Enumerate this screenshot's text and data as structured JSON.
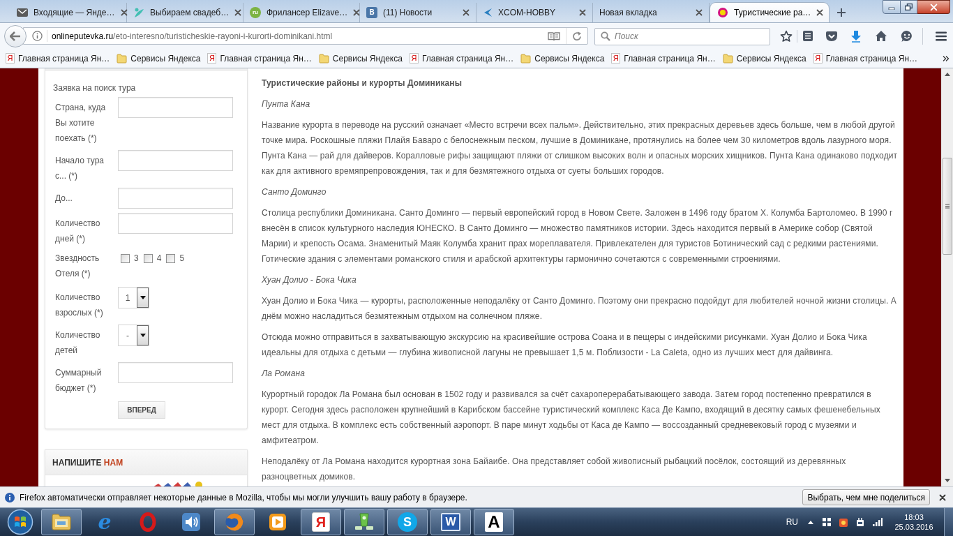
{
  "tabs": [
    {
      "title": "Входящие — Янде…",
      "kind": "mail",
      "selected": false
    },
    {
      "title": "Выбираем свадеб…",
      "kind": "bird",
      "selected": false
    },
    {
      "title": "Фрилансер Elizave…",
      "kind": "round_letter",
      "icon_text": "ru",
      "selected": false
    },
    {
      "title": "(11) Новости",
      "kind": "square_letter",
      "icon_text": "В",
      "selected": false
    },
    {
      "title": "XCOM-HOBBY",
      "kind": "chevron",
      "selected": false
    },
    {
      "title": "Новая вкладка",
      "kind": "plain",
      "selected": false
    },
    {
      "title": "Туристические ра…",
      "kind": "ring",
      "selected": true
    }
  ],
  "address_bar": {
    "domain": "onlineputevka.ru",
    "path": "/eto-interesno/turisticheskie-rayoni-i-kurorti-dominikani.html"
  },
  "search": {
    "placeholder": "Поиск"
  },
  "bookmarks": [
    {
      "kind": "letter",
      "icon_text": "Я",
      "label": "Главная страница Ян…"
    },
    {
      "kind": "folder",
      "label": "Сервисы Яндекса"
    },
    {
      "kind": "letter",
      "icon_text": "Я",
      "label": "Главная страница Ян…"
    },
    {
      "kind": "folder",
      "label": "Сервисы Яндекса"
    },
    {
      "kind": "letter",
      "icon_text": "Я",
      "label": "Главная страница Ян…"
    },
    {
      "kind": "folder",
      "label": "Сервисы Яндекса"
    },
    {
      "kind": "letter",
      "icon_text": "Я",
      "label": "Главная страница Ян…"
    },
    {
      "kind": "folder",
      "label": "Сервисы Яндекса"
    },
    {
      "kind": "letter",
      "icon_text": "Я",
      "label": "Главная страница Ян…"
    }
  ],
  "form": {
    "title": "Заявка на поиск тура",
    "fields": [
      {
        "kind": "text",
        "label": "Страна, куда Вы хотите поехать (*)"
      },
      {
        "kind": "text",
        "label": "Начало тура с... (*)"
      },
      {
        "kind": "text",
        "label": "До..."
      },
      {
        "kind": "text",
        "label": "Количество дней (*)"
      },
      {
        "kind": "checkboxes",
        "label": "Звездность Отеля (*)",
        "options": [
          {
            "label": "3",
            "checked": false
          },
          {
            "label": "4",
            "checked": false
          },
          {
            "label": "5",
            "checked": false
          }
        ]
      },
      {
        "kind": "select",
        "label": "Количество взрослых (*)",
        "value": "1"
      },
      {
        "kind": "select",
        "label": "Количество детей",
        "value": "-"
      },
      {
        "kind": "text",
        "label": "Суммарный бюджет (*)"
      }
    ],
    "submit": "ВПЕРЕД"
  },
  "contact": {
    "title": "НАПИШИТЕ",
    "accent": "НАМ"
  },
  "article": {
    "title": "Туристические районы и курорты Доминиканы",
    "blocks": [
      {
        "kind": "heading",
        "text": "Пунта Кана"
      },
      {
        "kind": "paragraph",
        "text": "Название курорта в переводе на русский означает «Место встречи всех пальм». Действительно, этих прекрасных деревьев здесь больше, чем в любой другой точке мира. Роскошные пляжи Плайя Баваро с белоснежным песком, лучшие в Доминикане, протянулись на более чем 30 километров вдоль лазурного моря. Пунта Кана — рай для дайверов. Коралловые рифы защищают пляжи от слишком высоких волн и опасных морских хищников. Пунта Кана одинаково подходит как для активного времяпрепровождения, так и для безмятежного отдыха от суеты больших городов."
      },
      {
        "kind": "heading",
        "text": "Санто Доминго"
      },
      {
        "kind": "paragraph",
        "text": "Столица республики Доминикана. Санто Доминго — первый европейский город в Новом Свете. Заложен в 1496 году братом Х. Колумба Бартоломео. В 1990 г внесён в список культурного наследия ЮНЕСКО. В Санто Доминго — множество памятников истории. Здесь находится первый в Америке собор (Святой Марии) и крепость Осама. Знаменитый Маяк Колумба хранит прах мореплавателя. Привлекателен для туристов Ботинический сад с редкими растениями. Готические здания с элементами романского стиля и арабской архитектуры гармонично сочетаются с современными строениями."
      },
      {
        "kind": "heading",
        "text": "Хуан Долио - Бока Чика"
      },
      {
        "kind": "paragraph",
        "text": "Хуан Долио и Бока Чика — курорты, расположенные неподалёку от Санто Доминго. Поэтому они прекрасно подойдут для любителей ночной жизни столицы. А днём можно насладиться безмятежным отдыхом на солнечном пляже."
      },
      {
        "kind": "paragraph",
        "text": "Отсюда можно отправиться в захватывающую экскурсию на красивейшие острова Соана и в пещеры с индейскими рисунками. Хуан Долио и Бока Чика идеальны для отдыха с детьми — глубина живописной лагуны не превышает 1,5 м. Поблизости - La Caleta, одно из лучших мест для дайвинга."
      },
      {
        "kind": "heading",
        "text": "Ла Романа"
      },
      {
        "kind": "paragraph",
        "text": "Курортный городок Ла Романа был основан в 1502 году и развивался за счёт сахароперерабатывающего завода. Затем город постепенно превратился в курорт. Сегодня здесь расположен крупнейший в Карибском бассейне туристический комплекс Каса Де Кампо, входящий в десятку самых фешенебельных мест для отдыха. В комплекс есть собственный аэропорт. В паре минут ходьбы от Каса де Кампо — воссозданный средневековый город с музеями и амфитеатром."
      },
      {
        "kind": "paragraph",
        "text": "Неподалёку от Ла Романа находится курортная зона Байаибе. Она представляет собой живописный рыбацкий посёлок, состоящий из деревянных разноцветных домиков."
      }
    ]
  },
  "notification": {
    "message": "Firefox автоматически отправляет некоторые данные в Mozilla, чтобы мы могли улучшить вашу работу в браузере.",
    "button": "Выбрать, чем мне поделиться"
  },
  "taskbar": {
    "apps": [
      {
        "kind": "folder",
        "running": true
      },
      {
        "kind": "letter_e",
        "text": "e",
        "running": false
      },
      {
        "kind": "ring",
        "running": false
      },
      {
        "kind": "speaker",
        "running": false
      },
      {
        "kind": "globe",
        "running": true
      },
      {
        "kind": "play",
        "running": false
      },
      {
        "kind": "letter_tile",
        "text": "Я",
        "running": true
      },
      {
        "kind": "cup",
        "running": true
      },
      {
        "kind": "letter_circle",
        "text": "S",
        "running": true
      },
      {
        "kind": "letter_square",
        "text": "W",
        "running": true
      },
      {
        "kind": "letter_plain",
        "text": "A",
        "running": true
      }
    ],
    "language": "RU",
    "time": "18:03",
    "date": "25.03.2016"
  }
}
